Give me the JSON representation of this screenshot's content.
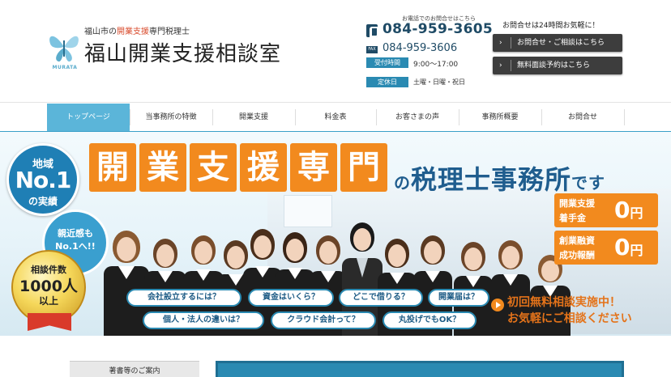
{
  "header": {
    "logo_text": "MURATA",
    "tagline_prefix": "福山市の",
    "tagline_highlight": "開業支援",
    "tagline_suffix": "専門税理士",
    "office_name": "福山開業支援相談室",
    "tel_note": "お電話でのお問合せはこちら",
    "tel": "084-959-3605",
    "fax_label": "FAX",
    "fax": "084-959-3606",
    "hours_label": "受付時間",
    "hours": "9:00～17:00",
    "closed_label": "定休日",
    "closed_days": "土曜・日曜・祝日",
    "contact_note": "お問合せは24時間お気軽に！",
    "cta_contact": "お問合せ・ご相談はこちら",
    "cta_reserve": "無料面談予約はこちら",
    "arrow": "›"
  },
  "nav": {
    "items": [
      "トップページ",
      "当事務所の特徴",
      "開業支援",
      "料金表",
      "お客さまの声",
      "事務所概要",
      "お問合せ"
    ],
    "active_index": 0
  },
  "hero": {
    "badge_region": {
      "line1": "地域",
      "line2": "No.1",
      "line3": "の実績"
    },
    "badge_friendly": {
      "line1": "親近感も",
      "line2": "No.1へ!!"
    },
    "badge_gold": {
      "line1": "相談件数",
      "line2": "1000人",
      "line3": "以上"
    },
    "headline_chars": [
      "開",
      "業",
      "支",
      "援",
      "専",
      "門"
    ],
    "headline_particle": "の",
    "headline_rest": "税理士事務所",
    "headline_end": "です",
    "promo_1": {
      "line1": "開業支援",
      "line2": "着手金",
      "value": "0",
      "unit": "円"
    },
    "promo_2": {
      "line1": "創業融資",
      "line2": "成功報酬",
      "value": "0",
      "unit": "円"
    },
    "questions": [
      "会社設立するには？",
      "資金はいくら？",
      "どこで借りる？",
      "開業届は？",
      "個人・法人の違いは？",
      "クラウド会計って？",
      "丸投げでもOK？"
    ],
    "cta_line1": "初回無料相談実施中！",
    "cta_line2": "お気軽にご相談ください"
  },
  "sidebar": {
    "title": "著書等のご案内"
  },
  "colors": {
    "accent": "#3aa0c8",
    "brand_dark": "#1f4b66",
    "orange": "#f28a1e",
    "headline_blue": "#1f5d8e"
  }
}
